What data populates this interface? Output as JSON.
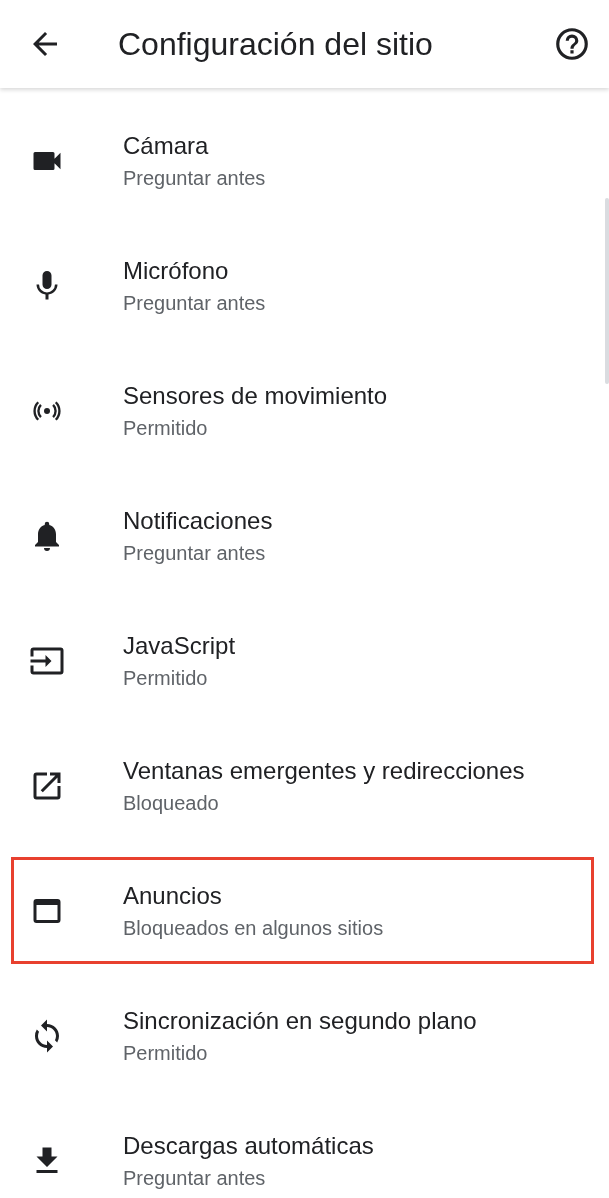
{
  "header": {
    "title": "Configuración del sitio"
  },
  "settings": [
    {
      "title": "Cámara",
      "subtitle": "Preguntar antes",
      "highlighted": false
    },
    {
      "title": "Micrófono",
      "subtitle": "Preguntar antes",
      "highlighted": false
    },
    {
      "title": "Sensores de movimiento",
      "subtitle": "Permitido",
      "highlighted": false
    },
    {
      "title": "Notificaciones",
      "subtitle": "Preguntar antes",
      "highlighted": false
    },
    {
      "title": "JavaScript",
      "subtitle": "Permitido",
      "highlighted": false
    },
    {
      "title": "Ventanas emergentes y redirecciones",
      "subtitle": "Bloqueado",
      "highlighted": false
    },
    {
      "title": "Anuncios",
      "subtitle": "Bloqueados en algunos sitios",
      "highlighted": true
    },
    {
      "title": "Sincronización en segundo plano",
      "subtitle": "Permitido",
      "highlighted": false
    },
    {
      "title": "Descargas automáticas",
      "subtitle": "Preguntar antes",
      "highlighted": false
    }
  ]
}
